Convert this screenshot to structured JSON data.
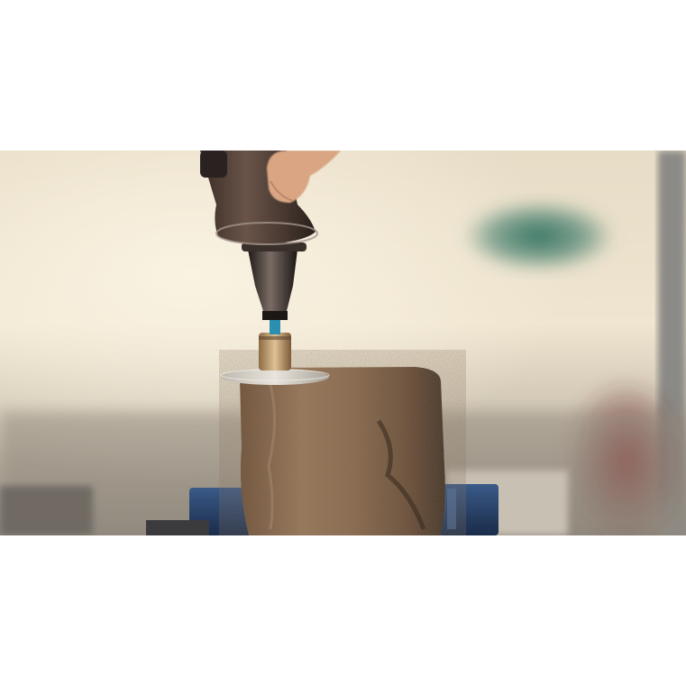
{
  "image": {
    "scene": "rotary-tool-cutting-wood-log",
    "colors": {
      "background_top": "#ffffff",
      "backdrop_warm": "#e9dcc2",
      "backdrop_shadow": "#9c948a",
      "wood": "#8a6a4e",
      "wood_dark": "#4e3b2a",
      "vise_blue": "#22385c",
      "tool_dark": "#2b2320",
      "teal_blur": "#2f6f5f",
      "red_blur": "#8a2d2e",
      "skin": "#d9a583"
    }
  }
}
